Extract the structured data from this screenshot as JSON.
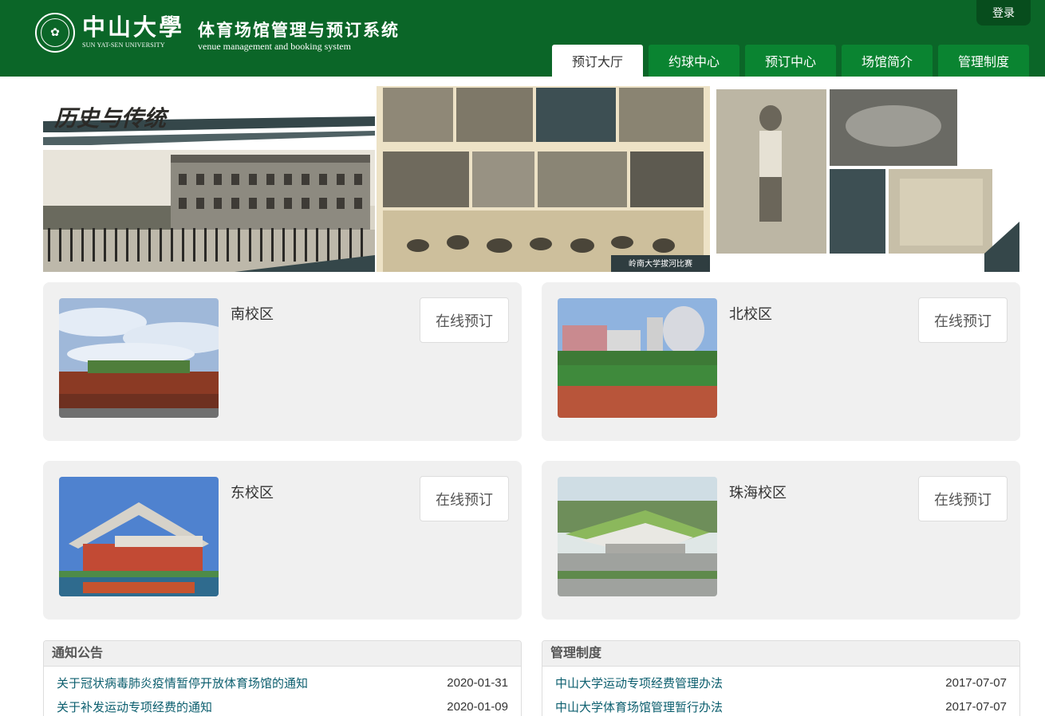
{
  "header": {
    "logo_cn": "中山大學",
    "logo_en": "SUN YAT-SEN UNIVERSITY",
    "system_title_cn": "体育场馆管理与预订系统",
    "system_title_en": "venue management and booking system",
    "login_label": "登录"
  },
  "nav": {
    "tabs": [
      {
        "label": "预订大厅",
        "active": true
      },
      {
        "label": "约球中心",
        "active": false
      },
      {
        "label": "预订中心",
        "active": false
      },
      {
        "label": "场馆简介",
        "active": false
      },
      {
        "label": "管理制度",
        "active": false
      }
    ]
  },
  "banner": {
    "heading": "历史与传统",
    "caption": "岭南大学拔河比赛"
  },
  "campuses": [
    {
      "name": "南校区",
      "button": "在线预订"
    },
    {
      "name": "北校区",
      "button": "在线预订"
    },
    {
      "name": "东校区",
      "button": "在线预订"
    },
    {
      "name": "珠海校区",
      "button": "在线预订"
    }
  ],
  "notices": {
    "title": "通知公告",
    "items": [
      {
        "title": "关于冠状病毒肺炎疫情暂停开放体育场馆的通知",
        "date": "2020-01-31"
      },
      {
        "title": "关于补发运动专项经费的通知",
        "date": "2020-01-09"
      }
    ]
  },
  "rules": {
    "title": "管理制度",
    "items": [
      {
        "title": "中山大学运动专项经费管理办法",
        "date": "2017-07-07"
      },
      {
        "title": "中山大学体育场馆管理暂行办法",
        "date": "2017-07-07"
      }
    ]
  },
  "colors": {
    "header_green": "#0b6628",
    "tab_green": "#0a8431",
    "link_teal": "#0b5e6e",
    "card_bg": "#f0f0f0"
  }
}
